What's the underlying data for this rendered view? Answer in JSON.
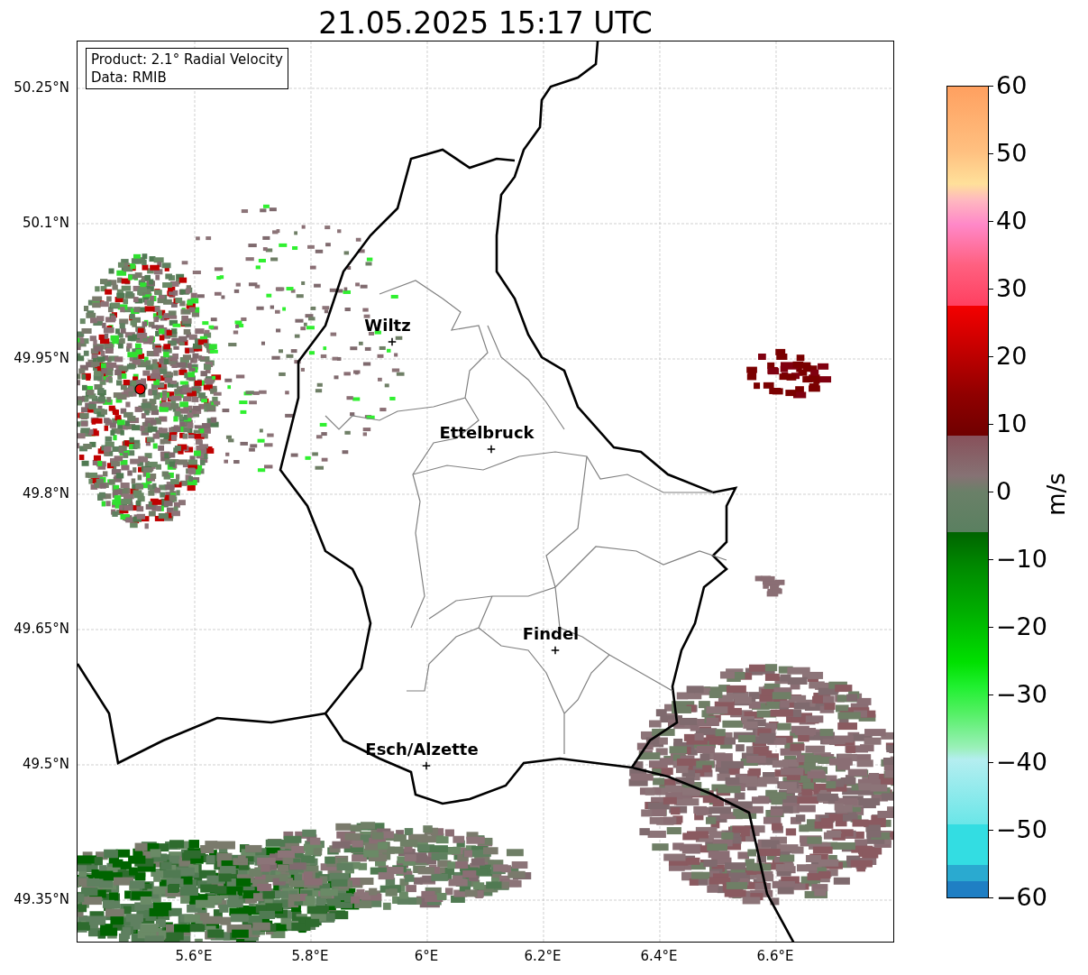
{
  "title": "21.05.2025 15:17 UTC",
  "legend": [
    "Product: 2.1° Radial Velocity",
    "Data: RMIB"
  ],
  "cities": [
    {
      "name": "Wiltz"
    },
    {
      "name": "Ettelbruck"
    },
    {
      "name": "Findel"
    },
    {
      "name": "Esch/Alzette"
    }
  ],
  "y_ticks": [
    "50.25°N",
    "50.1°N",
    "49.95°N",
    "49.8°N",
    "49.65°N",
    "49.5°N",
    "49.35°N"
  ],
  "x_ticks": [
    "5.6°E",
    "5.8°E",
    "6°E",
    "6.2°E",
    "6.4°E",
    "6.6°E"
  ],
  "colorbar": {
    "unit": "m/s",
    "ticks": [
      "60",
      "50",
      "40",
      "30",
      "20",
      "10",
      "0",
      "−10",
      "−20",
      "−30",
      "−40",
      "−50",
      "−60"
    ]
  }
}
